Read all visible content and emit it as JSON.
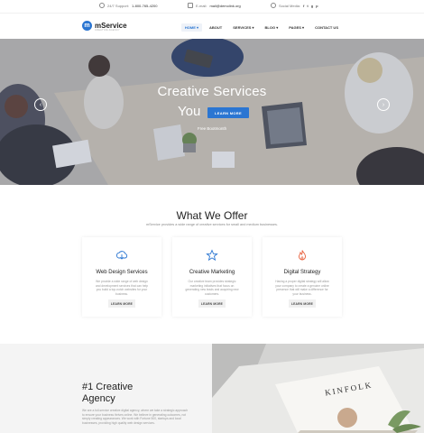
{
  "topbar": {
    "support_label": "24/7 Support:",
    "support_phone": "1-800-765-4200",
    "email_label": "E-mail:",
    "email_value": "mail@demolink.org",
    "social_label": "Social Media:",
    "social_icons": [
      "f",
      "t",
      "g",
      "p"
    ]
  },
  "navbar": {
    "logo_letter": "m",
    "logo_text": "mService",
    "logo_tagline": "CREATIVE AGENCY",
    "items": [
      {
        "label": "HOME ▾",
        "active": true
      },
      {
        "label": "ABOUT",
        "active": false
      },
      {
        "label": "SERVICES ▾",
        "active": false
      },
      {
        "label": "BLOG ▾",
        "active": false
      },
      {
        "label": "PAGES ▾",
        "active": false
      },
      {
        "label": "CONTACT US",
        "active": false
      }
    ]
  },
  "hero": {
    "title_line1": "Creative Services",
    "title_line2": "You",
    "button_label": "LEARN MORE",
    "subtitle": "Free Bootmonth",
    "prev_icon": "‹",
    "next_icon": "›"
  },
  "offer": {
    "title": "What We Offer",
    "subtitle": "mService provides a wide range of creative services for small and medium businesses.",
    "cards": [
      {
        "icon": "cloud-download-icon",
        "title": "Web Design Services",
        "text": "We provide a wide range of web design and development services that can help you build a top-notch websites for your business.",
        "button": "LEARN MORE"
      },
      {
        "icon": "star-icon",
        "title": "Creative Marketing",
        "text": "Our creative team provides strategic marketing initiatives that focus on generating new leads and acquiring new customers.",
        "button": "LEARN MORE"
      },
      {
        "icon": "fire-icon",
        "title": "Digital Strategy",
        "text": "Having a proper digital strategy will allow your company to create a genuine online presence that will make a difference for your business.",
        "button": "LEARN MORE"
      }
    ]
  },
  "agency": {
    "title_line1": "#1 Creative",
    "title_line2": "Agency",
    "text": "We are a full-service creative digital agency, where we take a strategic approach to ensure your business thrives online. We believe in generating outcomes, not simply creating appearances. We work with Fortune 500, startups and local businesses, providing high quality web design services.",
    "magazine_text": "KINFOLK"
  },
  "colors": {
    "accent": "#2b76d2",
    "icon_star": "#2b76d2",
    "icon_fire": "#e8603c"
  }
}
